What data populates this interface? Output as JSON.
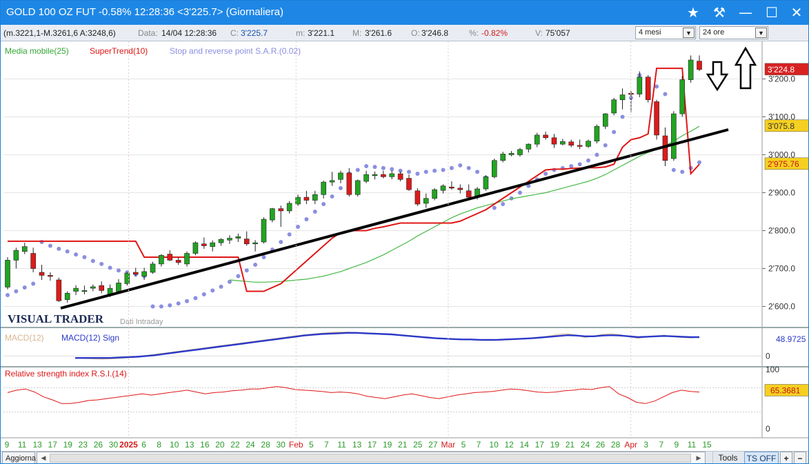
{
  "window": {
    "title": "GOLD 100 OZ FUT -0.58% 12:28:36  <3'225.7>  (Giornaliera)",
    "controls": [
      "★",
      "⚒",
      "—",
      "☐",
      "✕"
    ]
  },
  "infobar": {
    "prefix": "(m.3221,1-M.3261,6 A:3248,6)",
    "date_label": "Data:",
    "date_value": "14/04 12:28:36",
    "close_label": "C:",
    "close_value": "3'225.7",
    "min_label": "m:",
    "min_value": "3'221.1",
    "max_label": "M:",
    "max_value": "3'261.6",
    "open_label": "O:",
    "open_value": "3'246.8",
    "pct_label": "%:",
    "pct_value": "-0.82%",
    "vol_label": "V:",
    "vol_value": "75'057",
    "period_select": "4 mesi",
    "timeframe_select": "24 ore"
  },
  "bottombar": {
    "refresh": "Aggiorna",
    "tools": "Tools",
    "ts": "TS OFF",
    "plus": "+",
    "minus": "−"
  },
  "chart_data": [
    {
      "type": "candlestick",
      "panel": "price",
      "legend": [
        "Media mobile(25)",
        "SuperTrend(10)",
        "Stop and reverse point S.A.R.(0.02)"
      ],
      "watermark": "VISUAL TRADER",
      "watermark_sub": "Dati Intraday",
      "y_ticks": [
        2600,
        2700,
        2800,
        2900,
        3000,
        3100,
        3200
      ],
      "y_tick_labels": [
        "2'600.0",
        "2'700.0",
        "2'800.0",
        "2'900.0",
        "3'000.0",
        "3'100.0",
        "3'200.0"
      ],
      "price_labels": {
        "last": "3'224.8",
        "ma": "3'075.8",
        "st": "2'975.76"
      },
      "x_labels": [
        "9",
        "11",
        "13",
        "17",
        "19",
        "23",
        "26",
        "30",
        "2025",
        "6",
        "8",
        "10",
        "13",
        "16",
        "20",
        "22",
        "24",
        "28",
        "30",
        "Feb",
        "5",
        "7",
        "11",
        "13",
        "17",
        "19",
        "21",
        "25",
        "27",
        "Mar",
        "5",
        "7",
        "10",
        "12",
        "14",
        "17",
        "19",
        "21",
        "24",
        "26",
        "28",
        "Apr",
        "3",
        "7",
        "9",
        "11",
        "15"
      ],
      "month_labels": [
        "2025",
        "Feb",
        "Mar",
        "Apr"
      ],
      "ohlc": [
        [
          2651,
          2730,
          2645,
          2722
        ],
        [
          2722,
          2755,
          2700,
          2748
        ],
        [
          2745,
          2768,
          2738,
          2758
        ],
        [
          2740,
          2755,
          2690,
          2700
        ],
        [
          2690,
          2710,
          2670,
          2682
        ],
        [
          2682,
          2690,
          2668,
          2680
        ],
        [
          2670,
          2676,
          2612,
          2615
        ],
        [
          2618,
          2640,
          2610,
          2635
        ],
        [
          2640,
          2656,
          2630,
          2648
        ],
        [
          2640,
          2655,
          2632,
          2642
        ],
        [
          2648,
          2658,
          2640,
          2652
        ],
        [
          2655,
          2666,
          2635,
          2642
        ],
        [
          2632,
          2658,
          2625,
          2648
        ],
        [
          2640,
          2672,
          2636,
          2662
        ],
        [
          2660,
          2690,
          2655,
          2688
        ],
        [
          2690,
          2702,
          2680,
          2685
        ],
        [
          2680,
          2702,
          2670,
          2692
        ],
        [
          2690,
          2718,
          2686,
          2712
        ],
        [
          2712,
          2738,
          2705,
          2735
        ],
        [
          2738,
          2748,
          2720,
          2722
        ],
        [
          2722,
          2730,
          2710,
          2716
        ],
        [
          2712,
          2745,
          2705,
          2740
        ],
        [
          2740,
          2772,
          2735,
          2768
        ],
        [
          2765,
          2782,
          2752,
          2760
        ],
        [
          2758,
          2774,
          2745,
          2768
        ],
        [
          2768,
          2780,
          2760,
          2777
        ],
        [
          2775,
          2788,
          2765,
          2780
        ],
        [
          2780,
          2792,
          2770,
          2784
        ],
        [
          2778,
          2798,
          2760,
          2765
        ],
        [
          2765,
          2775,
          2745,
          2768
        ],
        [
          2770,
          2835,
          2766,
          2830
        ],
        [
          2828,
          2860,
          2822,
          2858
        ],
        [
          2858,
          2866,
          2810,
          2852
        ],
        [
          2852,
          2878,
          2845,
          2872
        ],
        [
          2870,
          2895,
          2865,
          2888
        ],
        [
          2888,
          2905,
          2870,
          2880
        ],
        [
          2880,
          2905,
          2870,
          2895
        ],
        [
          2895,
          2932,
          2885,
          2928
        ],
        [
          2928,
          2955,
          2918,
          2932
        ],
        [
          2935,
          2958,
          2925,
          2952
        ],
        [
          2952,
          2965,
          2890,
          2895
        ],
        [
          2895,
          2935,
          2890,
          2932
        ],
        [
          2930,
          2958,
          2925,
          2948
        ],
        [
          2945,
          2956,
          2935,
          2948
        ],
        [
          2948,
          2958,
          2938,
          2942
        ],
        [
          2942,
          2958,
          2935,
          2950
        ],
        [
          2950,
          2956,
          2930,
          2935
        ],
        [
          2938,
          2948,
          2905,
          2908
        ],
        [
          2905,
          2912,
          2865,
          2870
        ],
        [
          2872,
          2898,
          2860,
          2885
        ],
        [
          2885,
          2912,
          2880,
          2908
        ],
        [
          2906,
          2922,
          2898,
          2918
        ],
        [
          2915,
          2930,
          2908,
          2912
        ],
        [
          2912,
          2922,
          2898,
          2908
        ],
        [
          2905,
          2922,
          2880,
          2888
        ],
        [
          2888,
          2915,
          2882,
          2910
        ],
        [
          2910,
          2946,
          2905,
          2942
        ],
        [
          2942,
          2990,
          2938,
          2985
        ],
        [
          2985,
          3008,
          2980,
          3002
        ],
        [
          3000,
          3010,
          2996,
          3004
        ],
        [
          3000,
          3018,
          2995,
          3014
        ],
        [
          3015,
          3030,
          3006,
          3028
        ],
        [
          3028,
          3058,
          3020,
          3052
        ],
        [
          3052,
          3061,
          3040,
          3045
        ],
        [
          3045,
          3055,
          3018,
          3028
        ],
        [
          3028,
          3042,
          3025,
          3035
        ],
        [
          3034,
          3040,
          3020,
          3025
        ],
        [
          3025,
          3040,
          3015,
          3022
        ],
        [
          3022,
          3040,
          3018,
          3036
        ],
        [
          3036,
          3080,
          3030,
          3075
        ],
        [
          3075,
          3110,
          3068,
          3108
        ],
        [
          3110,
          3150,
          3104,
          3145
        ],
        [
          3145,
          3175,
          3120,
          3158
        ],
        [
          3162,
          3168,
          3112,
          3160
        ],
        [
          3160,
          3220,
          3152,
          3205
        ],
        [
          3205,
          3210,
          3138,
          3145
        ],
        [
          3140,
          3145,
          3040,
          3052
        ],
        [
          3050,
          3072,
          2970,
          2985
        ],
        [
          2990,
          3115,
          2984,
          3108
        ],
        [
          3108,
          3208,
          3100,
          3198
        ],
        [
          3198,
          3262,
          3190,
          3250
        ],
        [
          3247,
          3262,
          3221,
          3225
        ]
      ],
      "sma25": [
        2670,
        2668,
        2666,
        2664,
        2664,
        2665,
        2666,
        2668,
        2670,
        2672,
        2676,
        2680,
        2686,
        2692,
        2700,
        2708,
        2716,
        2726,
        2736,
        2748,
        2760,
        2772,
        2786,
        2798,
        2810,
        2822,
        2834,
        2844,
        2852,
        2860,
        2866,
        2872,
        2878,
        2884,
        2888,
        2892,
        2896,
        2900,
        2906,
        2912,
        2918,
        2924,
        2930,
        2938,
        2948,
        2960,
        2972,
        2984,
        2996,
        3006,
        3014,
        3024,
        3036,
        3050,
        3062,
        3075
      ],
      "supertrend": [
        2772,
        2772,
        2772,
        2772,
        2772,
        2772,
        2772,
        2772,
        2772,
        2772,
        2772,
        2772,
        2772,
        2772,
        2772,
        2772,
        2730,
        2730,
        2730,
        2730,
        2730,
        2730,
        2730,
        2730,
        2730,
        2730,
        2730,
        2730,
        2640,
        2640,
        2640,
        2650,
        2660,
        2680,
        2700,
        2720,
        2740,
        2760,
        2780,
        2795,
        2800,
        2800,
        2800,
        2806,
        2810,
        2815,
        2820,
        2820,
        2820,
        2820,
        2820,
        2820,
        2820,
        2825,
        2835,
        2845,
        2855,
        2870,
        2885,
        2900,
        2915,
        2930,
        2945,
        2960,
        2962,
        2962,
        2964,
        2965,
        2966,
        2966,
        2968,
        2975,
        3020,
        3040,
        3045,
        3055,
        3228,
        3228,
        3228,
        3228,
        2950,
        2975
      ],
      "sar": [
        2630,
        2640,
        2650,
        2660,
        2770,
        2760,
        2752,
        2745,
        2737,
        2730,
        2720,
        2712,
        2702,
        2695,
        2690,
        2684,
        2680,
        2600,
        2600,
        2603,
        2608,
        2614,
        2622,
        2632,
        2642,
        2652,
        2665,
        2680,
        2695,
        2710,
        2730,
        2750,
        2770,
        2790,
        2810,
        2830,
        2850,
        2870,
        2890,
        2912,
        2950,
        2960,
        2970,
        2968,
        2965,
        2962,
        2958,
        2955,
        2950,
        2955,
        2958,
        2960,
        2965,
        2972,
        2965,
        2955,
        2940,
        2860,
        2870,
        2885,
        2900,
        2918,
        2935,
        2950,
        2960,
        2965,
        2970,
        2975,
        2985,
        3000,
        3025,
        3060,
        3100,
        3150,
        3210,
        3195,
        3180,
        3160,
        2960,
        2955,
        2965,
        2980
      ]
    },
    {
      "type": "line",
      "panel": "macd",
      "legend": [
        "MACD(12)",
        "MACD(12) Sign"
      ],
      "y_tick_labels": [
        "0"
      ],
      "value_label": "48.9725",
      "series": [
        {
          "name": "MACD(12)",
          "values": [
            -5,
            -6,
            -7,
            -8,
            -7,
            -6,
            -4,
            -2,
            1,
            4,
            7,
            10,
            13,
            16,
            19,
            22,
            25,
            28,
            31,
            34,
            37,
            40,
            43,
            46,
            49,
            52,
            55,
            57,
            59,
            61,
            62,
            62,
            61,
            60,
            59,
            58,
            57,
            55,
            53,
            51,
            49,
            47,
            45,
            44,
            43,
            42,
            41,
            40,
            41,
            42,
            43,
            45,
            47,
            49,
            52,
            56,
            58,
            54,
            48,
            52,
            56,
            58,
            55,
            50,
            46,
            49,
            52,
            54,
            50,
            48,
            47,
            49
          ]
        },
        {
          "name": "MACD(12) Sign",
          "values": [
            -5,
            -5,
            -5,
            -5,
            -5,
            -4,
            -3,
            -2,
            0,
            2,
            5,
            8,
            11,
            14,
            17,
            20,
            23,
            26,
            29,
            32,
            35,
            38,
            41,
            44,
            47,
            50,
            53,
            55,
            57,
            58,
            59,
            60,
            60,
            59,
            58,
            57,
            56,
            54,
            52,
            50,
            48,
            46,
            45,
            44,
            43,
            43,
            42,
            42,
            42,
            43,
            44,
            45,
            46,
            48,
            50,
            52,
            54,
            53,
            51,
            51,
            53,
            54,
            53,
            51,
            49,
            50,
            51,
            52,
            51,
            50,
            49,
            49
          ]
        }
      ]
    },
    {
      "type": "line",
      "panel": "rsi",
      "legend": [
        "Relative strength index R.S.I.(14)"
      ],
      "y_tick_labels": [
        "100",
        "0"
      ],
      "value_label": "65.3681",
      "series": [
        {
          "name": "Relative strength index R.S.I.(14)",
          "values": [
            62,
            66,
            68,
            63,
            55,
            50,
            44,
            44,
            46,
            49,
            50,
            52,
            54,
            56,
            58,
            60,
            58,
            60,
            62,
            64,
            66,
            63,
            60,
            62,
            63,
            65,
            66,
            68,
            68,
            70,
            72,
            70,
            67,
            66,
            65,
            64,
            62,
            63,
            62,
            60,
            56,
            54,
            52,
            55,
            58,
            60,
            57,
            54,
            52,
            55,
            58,
            60,
            62,
            63,
            64,
            66,
            68,
            67,
            65,
            63,
            62,
            63,
            65,
            66,
            68,
            67,
            70,
            72,
            60,
            54,
            46,
            44,
            48,
            55,
            62,
            66,
            64,
            63
          ]
        }
      ]
    }
  ]
}
